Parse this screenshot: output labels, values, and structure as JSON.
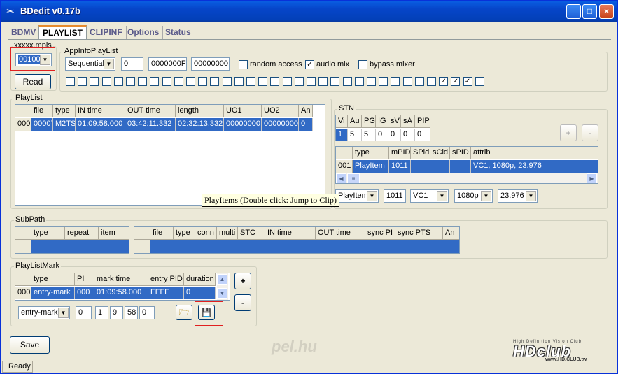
{
  "window": {
    "title": "BDedit v0.17b",
    "minimize": "_",
    "maximize": "□",
    "close": "×"
  },
  "tabs": [
    {
      "label": "BDMV"
    },
    {
      "label": "PLAYLIST"
    },
    {
      "label": "CLIPINF"
    },
    {
      "label": "Options"
    },
    {
      "label": "Status"
    }
  ],
  "file_group": {
    "label": "xxxxx.mpls",
    "value": "00100",
    "read_button": "Read"
  },
  "appinfo": {
    "label": "AppInfoPlayList",
    "playback_type": "Sequential",
    "field1": "0",
    "field2": "0000000F",
    "field3": "00000000",
    "random_access_label": "random access",
    "random_access": "",
    "audio_mix_label": "audio mix",
    "audio_mix": "✓",
    "bypass_mixer_label": "bypass mixer",
    "bypass_mixer": "",
    "uo_flags": [
      "",
      "",
      "",
      "",
      "",
      "",
      "",
      "",
      "",
      "",
      "",
      "",
      "",
      "",
      "",
      "",
      "",
      "",
      "",
      "",
      "",
      "",
      "",
      "",
      "",
      "",
      "",
      "",
      "",
      "",
      "",
      "✓",
      "✓",
      "✓",
      ""
    ]
  },
  "playlist": {
    "label": "PlayList",
    "columns": [
      "",
      "file",
      "type",
      "IN time",
      "OUT time",
      "length",
      "UO1",
      "UO2",
      "An"
    ],
    "rows": [
      [
        "000",
        "00007",
        "M2TS",
        "01:09:58.000",
        "03:42:11.332",
        "02:32:13.332",
        "00000000",
        "00000000",
        "0"
      ]
    ]
  },
  "stn": {
    "label": "STN",
    "count_columns": [
      "Vi",
      "Au",
      "PG",
      "IG",
      "sV",
      "sA",
      "PIP"
    ],
    "counts": [
      "1",
      "5",
      "5",
      "0",
      "0",
      "0",
      "0"
    ],
    "add_button": "+",
    "remove_button": "-",
    "stream_columns": [
      "",
      "type",
      "mPID",
      "SPid",
      "sCid",
      "sPID",
      "attrib"
    ],
    "streams": [
      [
        "001",
        "PlayItem",
        "1011",
        "",
        "",
        "",
        "VC1, 1080p, 23.976"
      ]
    ],
    "edit_type": "PlayItem",
    "edit_pid": "1011",
    "edit_codec": "VC1",
    "edit_res": "1080p",
    "edit_fps": "23.976"
  },
  "tooltip": "PlayItems (Double click: Jump to Clip)",
  "subpath": {
    "label": "SubPath",
    "left_columns": [
      "",
      "type",
      "repeat",
      "item"
    ],
    "right_columns": [
      "",
      "file",
      "type",
      "conn",
      "multi",
      "STC",
      "IN time",
      "OUT time",
      "sync PI",
      "sync PTS",
      "An"
    ]
  },
  "playlistmark": {
    "label": "PlayListMark",
    "columns": [
      "",
      "type",
      "PI",
      "mark time",
      "entry PID",
      "duration"
    ],
    "rows": [
      [
        "000",
        "entry-mark",
        "000",
        "01:09:58.000",
        "FFFF",
        "0"
      ]
    ],
    "edit_type": "entry-mark",
    "edit_pi": "0",
    "edit_h": "1",
    "edit_m": "9",
    "edit_s": "58",
    "edit_f": "0",
    "add_button": "+",
    "remove_button": "-"
  },
  "save_button": "Save",
  "watermark": "pel.hu",
  "logo": {
    "tagline": "High Definition Vision Club",
    "name": "HDclub",
    "url": "www.HD.CLUB.tw"
  },
  "status": "Ready"
}
